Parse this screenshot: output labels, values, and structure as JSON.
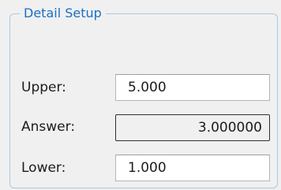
{
  "group": {
    "title": "Detail Setup"
  },
  "fields": {
    "upper": {
      "label": "Upper:",
      "value": "5.000"
    },
    "answer": {
      "label": "Answer:",
      "value": "3.000000"
    },
    "lower": {
      "label": "Lower:",
      "value": "1.000"
    }
  },
  "colors": {
    "title": "#1a6fc4",
    "group_border": "#aac8e4",
    "background": "#f0f0f0"
  }
}
